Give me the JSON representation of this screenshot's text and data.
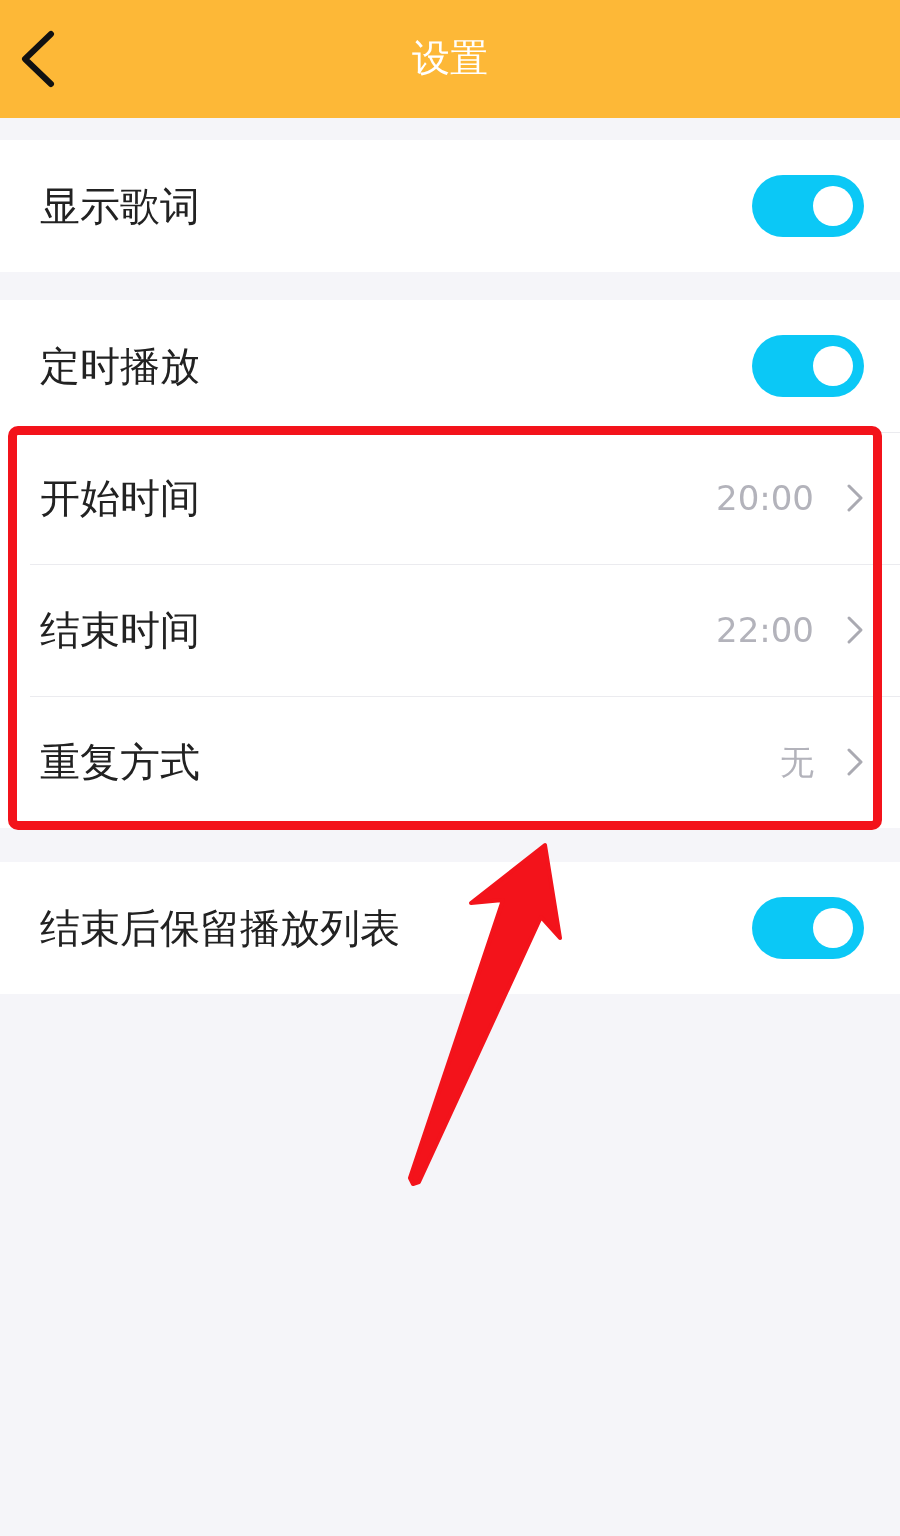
{
  "header": {
    "title": "设置"
  },
  "sections": [
    {
      "rows": [
        {
          "kind": "toggle",
          "label": "显示歌词",
          "on": true
        }
      ]
    },
    {
      "rows": [
        {
          "kind": "toggle",
          "label": "定时播放",
          "on": true
        },
        {
          "kind": "link",
          "label": "开始时间",
          "value": "20:00"
        },
        {
          "kind": "link",
          "label": "结束时间",
          "value": "22:00"
        },
        {
          "kind": "link",
          "label": "重复方式",
          "value": "无"
        }
      ]
    },
    {
      "rows": [
        {
          "kind": "toggle",
          "label": "结束后保留播放列表",
          "on": true
        }
      ]
    }
  ]
}
